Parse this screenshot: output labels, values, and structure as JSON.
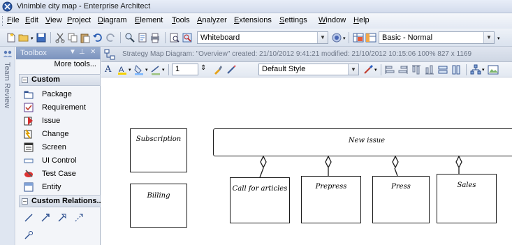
{
  "window": {
    "title": "Vinimble city map - Enterprise Architect"
  },
  "menu": {
    "items": [
      "File",
      "Edit",
      "View",
      "Project",
      "Diagram",
      "Element",
      "Tools",
      "Analyzer",
      "Extensions",
      "Settings",
      "Window",
      "Help"
    ]
  },
  "toolbar": {
    "perspective_combo": "Whiteboard",
    "workspace_combo": "Basic - Normal"
  },
  "side_strip": {
    "label": "Team Review"
  },
  "toolbox": {
    "title": "Toolbox",
    "more_tools": "More tools...",
    "sections": {
      "custom": "Custom",
      "custom_relations": "Custom Relations..."
    },
    "items": [
      {
        "label": "Package",
        "icon": "package-icon"
      },
      {
        "label": "Requirement",
        "icon": "requirement-icon"
      },
      {
        "label": "Issue",
        "icon": "issue-icon"
      },
      {
        "label": "Change",
        "icon": "change-icon"
      },
      {
        "label": "Screen",
        "icon": "screen-icon"
      },
      {
        "label": "UI Control",
        "icon": "ui-control-icon"
      },
      {
        "label": "Test Case",
        "icon": "test-case-icon"
      },
      {
        "label": "Entity",
        "icon": "entity-icon"
      }
    ]
  },
  "diagram": {
    "header": "Strategy Map Diagram: \"Overview\"  created: 21/10/2012 9:41:21  modified: 21/10/2012 10:15:06  100%  827 x 1169",
    "font_size_value": "1",
    "style_combo": "Default Style"
  },
  "canvas": {
    "shapes": {
      "subscription": "Subscription",
      "new_issue": "New issue",
      "billing": "Billing",
      "call_for_articles": "Call for articles",
      "prepress": "Prepress",
      "press": "Press",
      "sales": "Sales"
    }
  },
  "colors": {
    "title_bar": "#d3dcec",
    "toolbox_header": "#7b93bd",
    "canvas": "#ffffff"
  }
}
